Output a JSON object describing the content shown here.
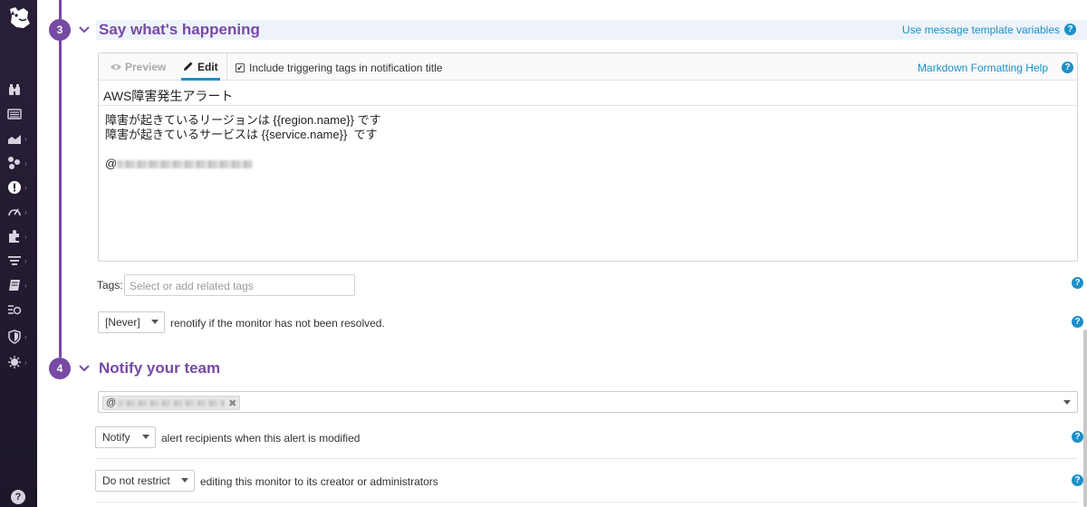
{
  "sidebar": {
    "items": [
      {
        "icon": "binoculars-icon"
      },
      {
        "icon": "dashboard-list-icon"
      },
      {
        "icon": "area-chart-icon"
      },
      {
        "icon": "infrastructure-icon"
      },
      {
        "icon": "monitors-alert-icon"
      },
      {
        "icon": "apm-gauge-icon"
      },
      {
        "icon": "integrations-puzzle-icon"
      },
      {
        "icon": "logs-filter-icon"
      },
      {
        "icon": "notebook-icon"
      },
      {
        "icon": "synthetics-icon"
      },
      {
        "icon": "security-shield-icon"
      },
      {
        "icon": "rum-virus-icon"
      }
    ],
    "help": "?"
  },
  "section3": {
    "number": "3",
    "title": "Say what's happening",
    "template_link": "Use message template variables"
  },
  "editor": {
    "tab_preview": "Preview",
    "tab_edit": "Edit",
    "include_tags_label": "Include triggering tags in notification title",
    "include_tags_checked": true,
    "markdown_help": "Markdown Formatting Help",
    "title_value": "AWS障害発生アラート",
    "body_line1": "障害が起きているリージョンは {{region.name}} です",
    "body_line2": "障害が起きているサービスは {{service.name}}  です",
    "mention_prefix": "@"
  },
  "tags": {
    "label": "Tags:",
    "placeholder": "Select or add related tags"
  },
  "renotify": {
    "selected": "[Never]",
    "text": "renotify if the monitor has not been resolved."
  },
  "section4": {
    "number": "4",
    "title": "Notify your team"
  },
  "notify_team": {
    "chip_prefix": "@",
    "chip_remove": "✖"
  },
  "modified": {
    "selected": "Notify",
    "text": "alert recipients when this alert is modified"
  },
  "restrict": {
    "selected": "Do not restrict",
    "text": "editing this monitor to its creator or administrators"
  },
  "help_glyph": "?",
  "colors": {
    "accent_purple": "#774aa4",
    "link_blue": "#1d8fc7",
    "sidebar_bg": "#241c32"
  }
}
